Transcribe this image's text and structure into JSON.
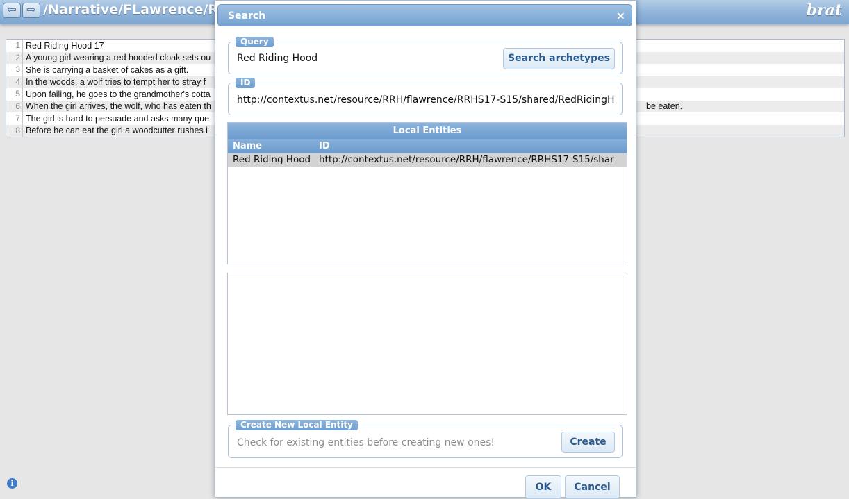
{
  "header": {
    "back_icon": "left-arrow-icon",
    "forward_icon": "right-arrow-icon",
    "back_glyph": "⇦",
    "forward_glyph": "⇨",
    "document_path": "/Narrative/FLawrence/RRHS",
    "logo": "brat"
  },
  "document": {
    "lines": [
      {
        "number": "1",
        "text": "Red Riding Hood 17",
        "right_text": ""
      },
      {
        "number": "2",
        "text": "A young girl wearing a red hooded cloak sets ou",
        "right_text": ""
      },
      {
        "number": "3",
        "text": "She is carrying a basket of cakes as a gift.",
        "right_text": ""
      },
      {
        "number": "4",
        "text": "In the woods, a wolf tries to tempt her to stray f",
        "right_text": ""
      },
      {
        "number": "5",
        "text": "Upon failing, he goes to the grandmother's cotta",
        "right_text": ""
      },
      {
        "number": "6",
        "text": "When the girl arrives, the wolf, who has eaten th",
        "right_text": "be eaten."
      },
      {
        "number": "7",
        "text": "The girl is hard to persuade and asks many que",
        "right_text": ""
      },
      {
        "number": "8",
        "text": "Before he can eat the girl a woodcutter rushes i",
        "right_text": ""
      }
    ]
  },
  "info_icon": "i",
  "dialog": {
    "title": "Search",
    "close_glyph": "×",
    "query": {
      "legend": "Query",
      "value": "Red Riding Hood",
      "button_label": "Search archetypes"
    },
    "id_field": {
      "legend": "ID",
      "value": "http://contextus.net/resource/RRH/flawrence/RRHS17-S15/shared/RedRidingH"
    },
    "local_entities": {
      "caption": "Local Entities",
      "columns": [
        "Name",
        "ID"
      ],
      "rows": [
        {
          "name": "Red Riding Hood",
          "id": "http://contextus.net/resource/RRH/flawrence/RRHS17-S15/shar"
        }
      ]
    },
    "create": {
      "legend": "Create New Local Entity",
      "hint": "Check for existing entities before creating new ones!",
      "button_label": "Create"
    },
    "ok_label": "OK",
    "cancel_label": "Cancel"
  },
  "colors": {
    "header_blue": "#8fb3d9",
    "legend_blue": "#6e9fd0",
    "button_text": "#2c5b8e",
    "selected_row": "#d3d3d3"
  }
}
